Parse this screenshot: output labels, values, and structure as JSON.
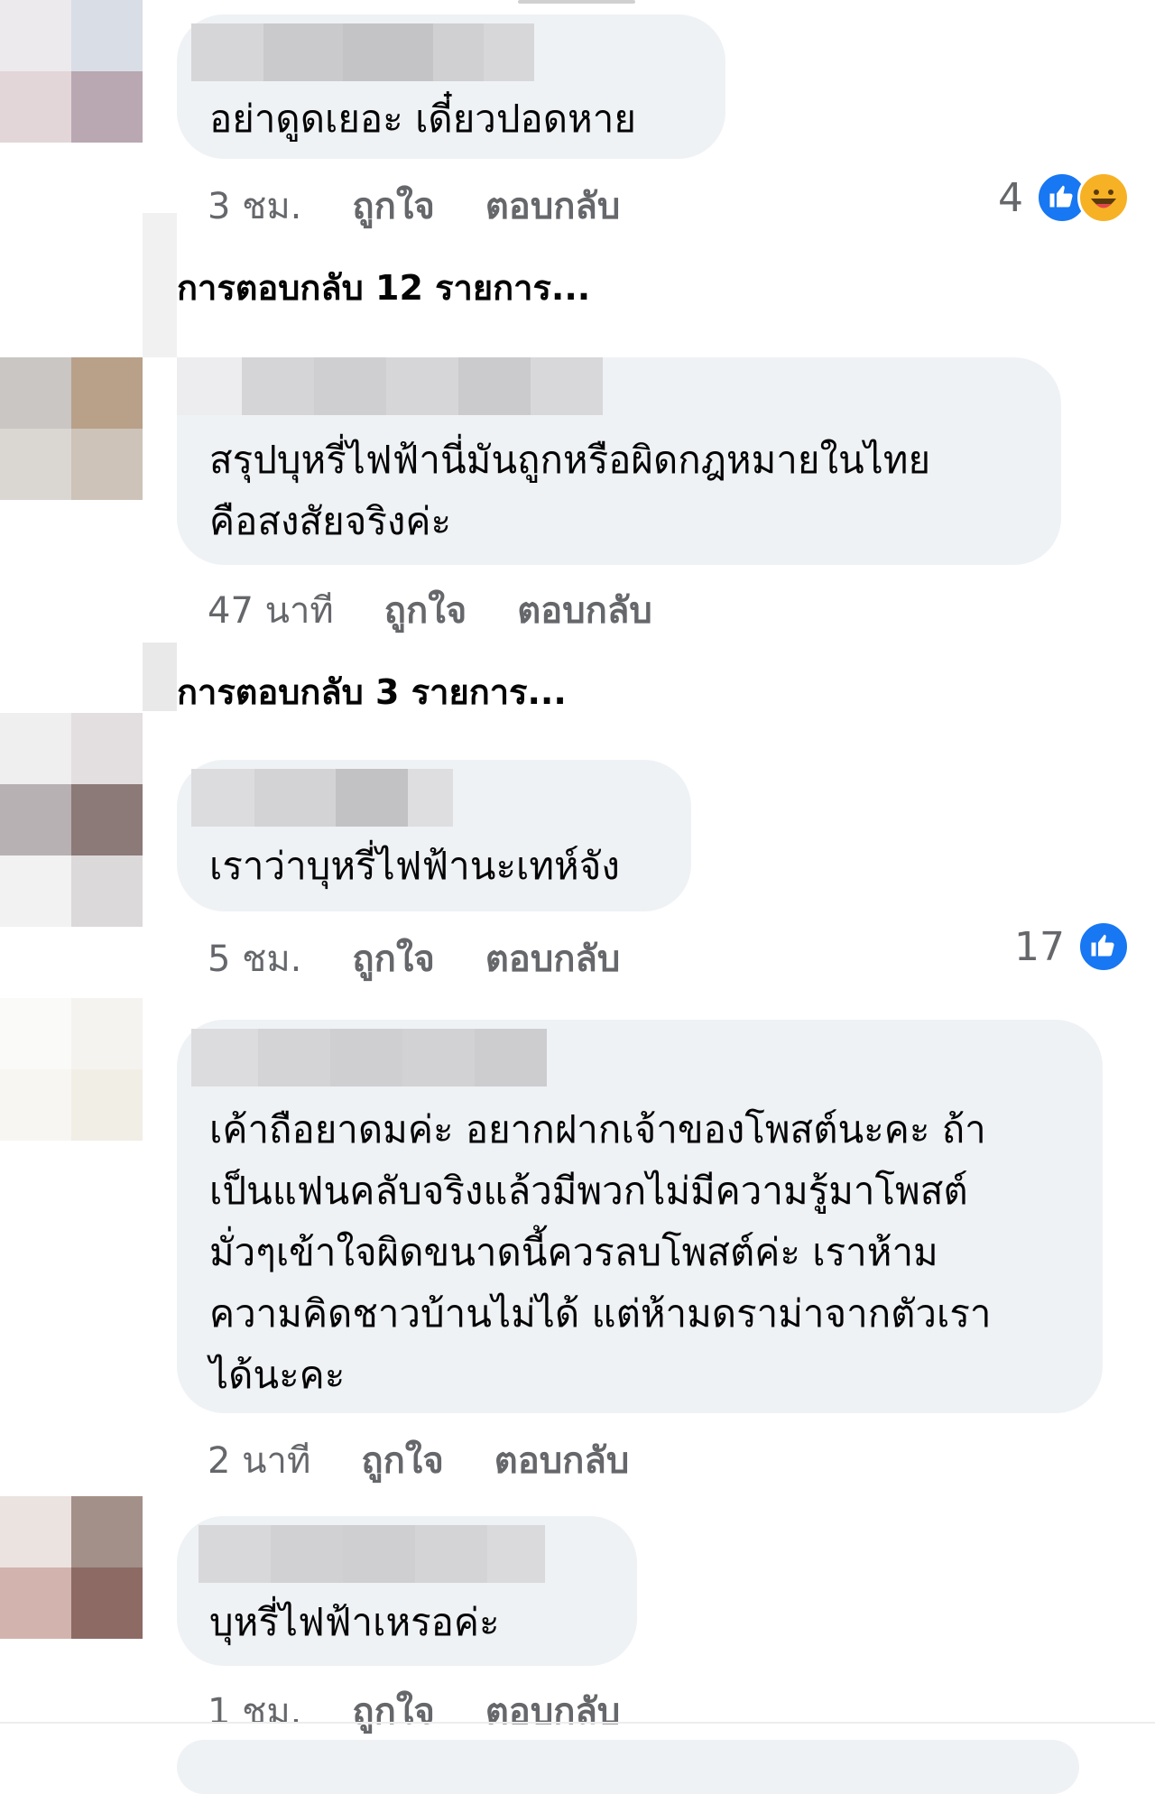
{
  "comments": [
    {
      "text": "อย่าดูดเยอะ เดี๋ยวปอดหาย",
      "time": "3 ชม.",
      "like_label": "ถูกใจ",
      "reply_label": "ตอบกลับ",
      "reaction_count": "4",
      "reactions": [
        "like-icon",
        "haha-icon"
      ],
      "replies_link": "การตอบกลับ 12 รายการ..."
    },
    {
      "text": "สรุปบุหรี่ไฟฟ้านี่มันถูกหรือผิดกฎหมายในไทย\nคือสงสัยจริงค่ะ",
      "time": "47 นาที",
      "like_label": "ถูกใจ",
      "reply_label": "ตอบกลับ",
      "replies_link": "การตอบกลับ 3 รายการ..."
    },
    {
      "text": "เราว่าบุหรี่ไฟฟ้านะเทห์จัง",
      "time": "5 ชม.",
      "like_label": "ถูกใจ",
      "reply_label": "ตอบกลับ",
      "reaction_count": "17",
      "reactions": [
        "like-icon"
      ]
    },
    {
      "text": "เค้าถือยาดมค่ะ อยากฝากเจ้าของโพสต์นะคะ ถ้า\nเป็นแฟนคลับจริงแล้วมีพวกไม่มีความรู้มาโพสต์\nมั่วๆเข้าใจผิดขนาดนี้ควรลบโพสต์ค่ะ เราห้าม\nความคิดชาวบ้านไม่ได้ แต่ห้ามดราม่าจากตัวเรา\nได้นะคะ",
      "time": "2 นาที",
      "like_label": "ถูกใจ",
      "reply_label": "ตอบกลับ"
    },
    {
      "text": "บุหรี่ไฟฟ้าเหรอค่ะ",
      "time": "1 ชม.",
      "like_label": "ถูกใจ",
      "reply_label": "ตอบกลับ"
    }
  ],
  "colors": {
    "bubble": "#eff2f5",
    "meta_text": "#65676b",
    "like_blue": "#1877f2",
    "haha_yellow": "#f7b125"
  }
}
